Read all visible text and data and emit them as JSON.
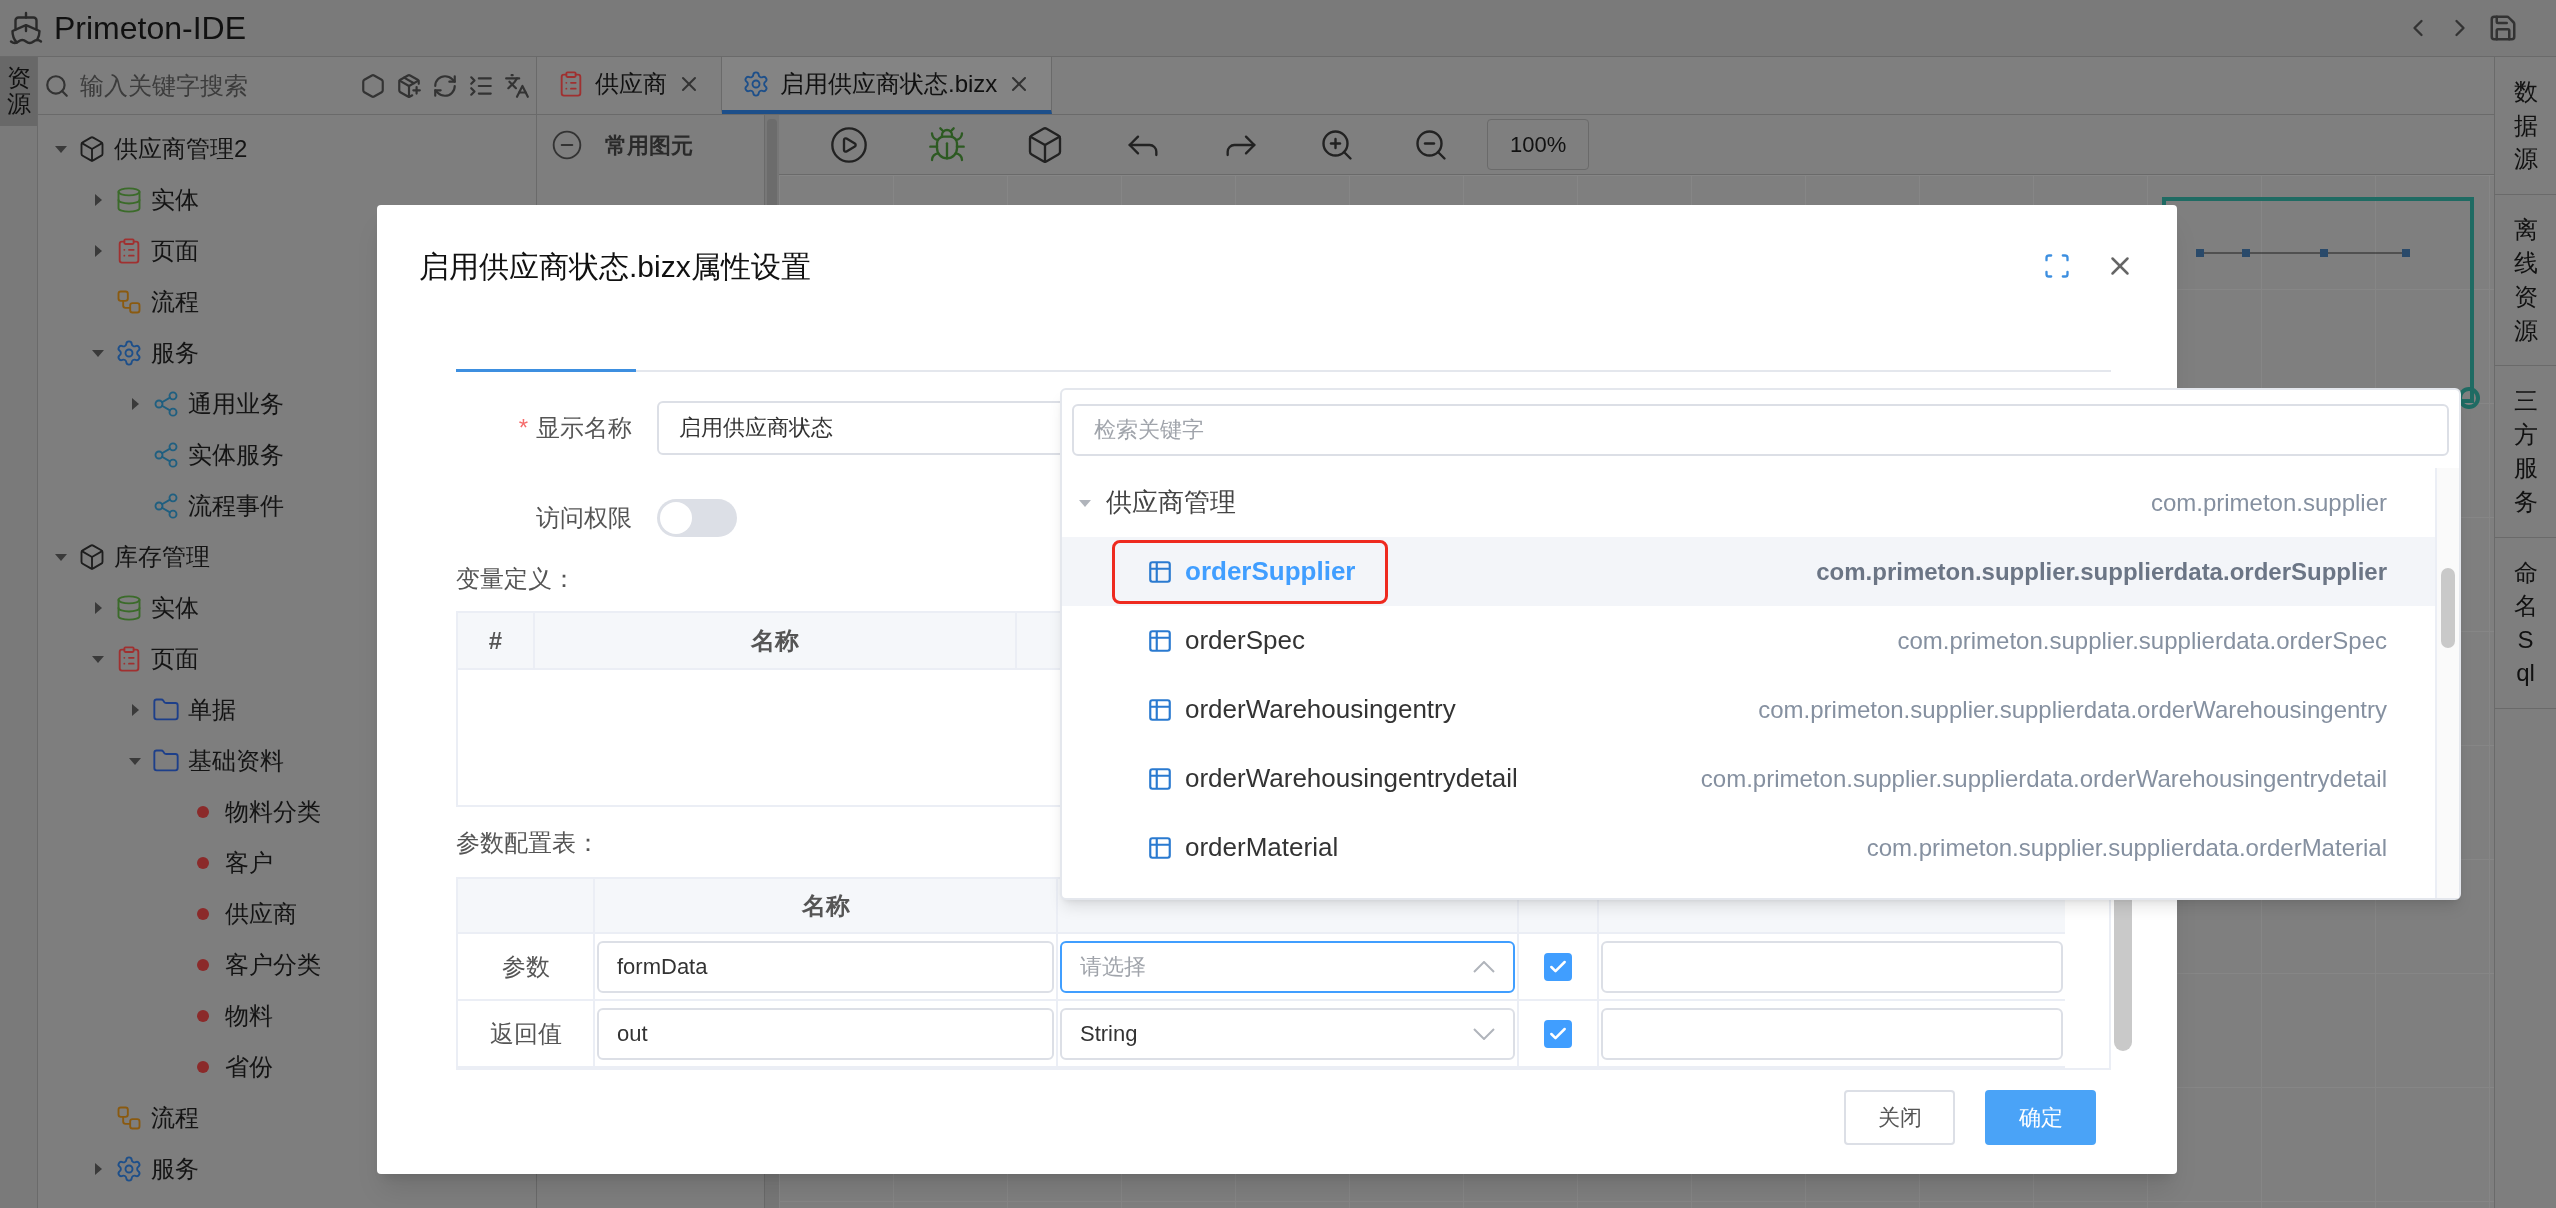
{
  "app": {
    "title": "Primeton-IDE"
  },
  "left_strip": [
    {
      "label": "资源",
      "selected": true
    }
  ],
  "sidebar": {
    "search_placeholder": "输入关键字搜索",
    "tree": [
      {
        "label": "供应商管理2",
        "kind": "cube",
        "expanded": true,
        "children": [
          {
            "label": "实体",
            "kind": "database",
            "expanded": false
          },
          {
            "label": "页面",
            "kind": "page",
            "expanded": false
          },
          {
            "label": "流程",
            "kind": "flow"
          },
          {
            "label": "服务",
            "kind": "gear",
            "expanded": true,
            "children": [
              {
                "label": "通用业务",
                "kind": "share",
                "expanded": false
              },
              {
                "label": "实体服务",
                "kind": "share"
              },
              {
                "label": "流程事件",
                "kind": "share"
              }
            ]
          }
        ]
      },
      {
        "label": "库存管理",
        "kind": "cube",
        "expanded": true,
        "children": [
          {
            "label": "实体",
            "kind": "database",
            "expanded": false
          },
          {
            "label": "页面",
            "kind": "page",
            "expanded": true,
            "children": [
              {
                "label": "单据",
                "kind": "folder",
                "expanded": false
              },
              {
                "label": "基础资料",
                "kind": "folder",
                "expanded": true,
                "children": [
                  {
                    "label": "物料分类",
                    "kind": "dot"
                  },
                  {
                    "label": "客户",
                    "kind": "dot"
                  },
                  {
                    "label": "供应商",
                    "kind": "dot"
                  },
                  {
                    "label": "客户分类",
                    "kind": "dot"
                  },
                  {
                    "label": "物料",
                    "kind": "dot"
                  },
                  {
                    "label": "省份",
                    "kind": "dot"
                  }
                ]
              }
            ]
          },
          {
            "label": "流程",
            "kind": "flow"
          },
          {
            "label": "服务",
            "kind": "gear",
            "expanded": false
          }
        ]
      }
    ]
  },
  "tabs": [
    {
      "label": "供应商",
      "kind": "page",
      "selected": false
    },
    {
      "label": "启用供应商状态.bizx",
      "kind": "gear",
      "selected": true
    }
  ],
  "palette": {
    "title": "常用图元"
  },
  "toolbar": {
    "zoom": "100%"
  },
  "right_strip": [
    "数据源",
    "离线资源",
    "三方服务",
    "命名Sql"
  ],
  "dialog": {
    "title": "启用供应商状态.bizx属性设置",
    "display_name": {
      "label": "显示名称",
      "required": true,
      "required_mark": "*",
      "value": "启用供应商状态"
    },
    "access": {
      "label": "访问权限",
      "on": false
    },
    "variables": {
      "label": "变量定义：",
      "columns": [
        "#",
        "名称"
      ]
    },
    "params": {
      "label": "参数配置表：",
      "name_column": "名称",
      "rows": [
        {
          "label": "参数",
          "name": "formData",
          "type_placeholder": "请选择",
          "open": true,
          "required": true
        },
        {
          "label": "返回值",
          "name": "out",
          "type": "String",
          "open": false,
          "required": true
        }
      ]
    },
    "buttons": [
      {
        "label": "关闭",
        "kind": "secondary"
      },
      {
        "label": "确定",
        "kind": "primary"
      }
    ]
  },
  "dropdown": {
    "placeholder": "检索关键字",
    "group": {
      "label": "供应商管理",
      "package": "com.primeton.supplier",
      "expanded": true,
      "items": [
        {
          "name": "orderSupplier",
          "path": "com.primeton.supplier.supplierdata.orderSupplier",
          "selected": true,
          "highlighted": true
        },
        {
          "name": "orderSpec",
          "path": "com.primeton.supplier.supplierdata.orderSpec",
          "selected": false,
          "highlighted": false
        },
        {
          "name": "orderWarehousingentry",
          "path": "com.primeton.supplier.supplierdata.orderWarehousingentry",
          "selected": false,
          "highlighted": false
        },
        {
          "name": "orderWarehousingentrydetail",
          "path": "com.primeton.supplier.supplierdata.orderWarehousingentrydetail",
          "selected": false,
          "highlighted": false
        },
        {
          "name": "orderMaterial",
          "path": "com.primeton.supplier.supplierdata.orderMaterial",
          "selected": false,
          "highlighted": false
        }
      ]
    }
  }
}
